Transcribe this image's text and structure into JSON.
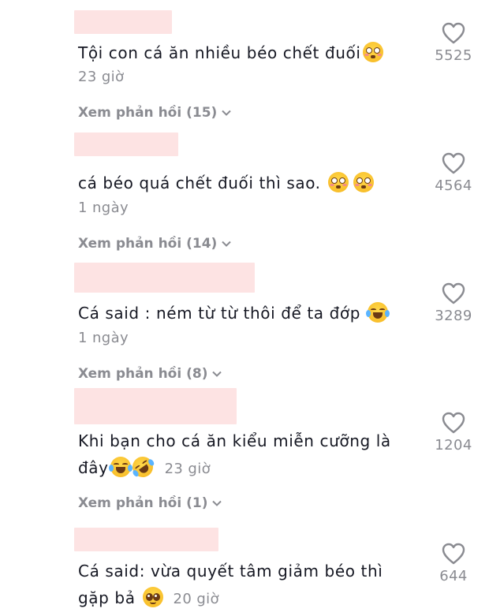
{
  "comments": [
    {
      "text": "Tội con cá ăn nhiều béo chết đuối",
      "emojis": [
        "flushed-face"
      ],
      "time": "23 giờ",
      "replies": "Xem phản hồi (15)",
      "likes": "5525"
    },
    {
      "text": "cá béo quá chết đuối thì sao.",
      "emojis": [
        "flushed-face",
        "flushed-face"
      ],
      "time": "1 ngày",
      "replies": "Xem phản hồi (14)",
      "likes": "4564"
    },
    {
      "text": "Cá said : ném từ từ thôi để ta đớp",
      "emojis": [
        "tears-of-joy-face"
      ],
      "time": "1 ngày",
      "replies": "Xem phản hồi (8)",
      "likes": "3289"
    },
    {
      "text_line1": "Khi bạn cho cá ăn kiểu miễn cưỡng là",
      "text_line2": "đây",
      "emojis": [
        "tears-of-joy-face",
        "rolling-on-floor-laughing-face"
      ],
      "time": "23 giờ",
      "replies": "Xem phản hồi (1)",
      "likes": "1204"
    },
    {
      "text_line1": "Cá said: vừa quyết tâm giảm béo thì",
      "text_line2": "gặp bả",
      "emojis": [
        "pleading-face"
      ],
      "time": "20 giờ",
      "likes": "644"
    }
  ],
  "colors": {
    "name_redaction": "#fde3e3",
    "secondary_text": "#8a8b91",
    "primary_text": "#161823"
  }
}
